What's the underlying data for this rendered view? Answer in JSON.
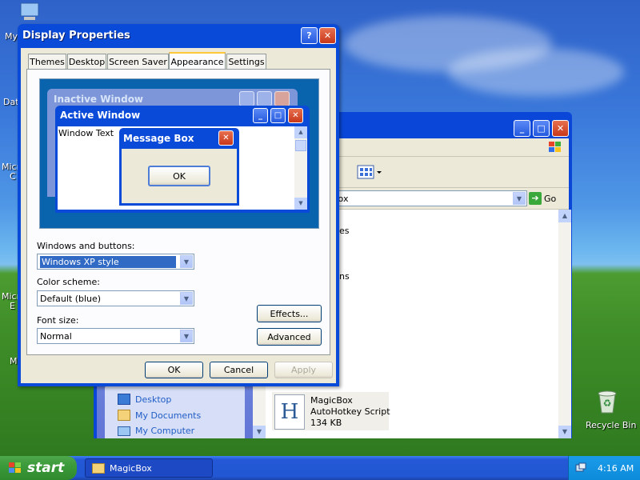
{
  "desktop": {
    "icons": [
      {
        "label": "My",
        "icon": "my-computer-icon"
      },
      {
        "label": "Dat",
        "icon": "folder-icon"
      },
      {
        "label": "Micr",
        "icon": "app-icon"
      },
      {
        "label": "C",
        "icon": "app-icon"
      },
      {
        "label": "Micr",
        "icon": "app-icon"
      },
      {
        "label": "E",
        "icon": "app-icon"
      },
      {
        "label": "M",
        "icon": "app-icon"
      }
    ],
    "recycle_bin": "Recycle Bin"
  },
  "taskbar": {
    "start_label": "start",
    "task_button": "MagicBox",
    "clock": "4:16 AM"
  },
  "explorer": {
    "address_value": "Box",
    "go_label": "Go",
    "partial_text_1": "es",
    "partial_text_2": "ns",
    "tasks": [
      {
        "label": "Desktop",
        "icon": "desktop-icon"
      },
      {
        "label": "My Documents",
        "icon": "documents-icon"
      },
      {
        "label": "My Computer",
        "icon": "computer-icon"
      }
    ],
    "file": {
      "name": "MagicBox",
      "type": "AutoHotkey Script",
      "size": "134 KB",
      "icon_letter": "H"
    }
  },
  "display_properties": {
    "title": "Display Properties",
    "tabs": [
      "Themes",
      "Desktop",
      "Screen Saver",
      "Appearance",
      "Settings"
    ],
    "active_tab": "Appearance",
    "preview": {
      "inactive_title": "Inactive Window",
      "active_title": "Active Window",
      "window_text": "Window Text",
      "message_title": "Message Box",
      "ok": "OK"
    },
    "windows_buttons_label": "Windows and buttons:",
    "windows_buttons_value": "Windows XP style",
    "color_scheme_label": "Color scheme:",
    "color_scheme_value": "Default (blue)",
    "font_size_label": "Font size:",
    "font_size_value": "Normal",
    "effects_button": "Effects...",
    "advanced_button": "Advanced",
    "ok_button": "OK",
    "cancel_button": "Cancel",
    "apply_button": "Apply"
  },
  "colors": {
    "title_bar": "#0a4ad9",
    "dialog_bg": "#ece9d8",
    "selection": "#316ac5",
    "close_red": "#d8532c",
    "start_green": "#3b9a3a"
  }
}
